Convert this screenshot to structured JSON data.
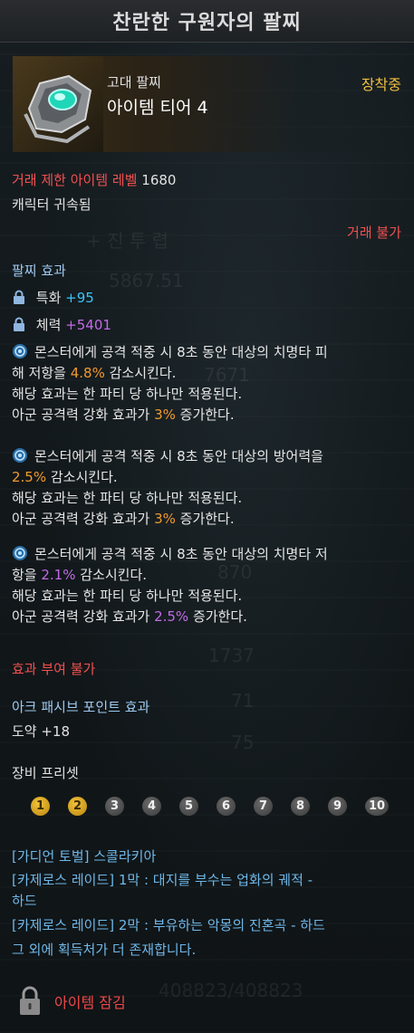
{
  "item": {
    "name": "찬란한 구원자의 팔찌",
    "grade": "고대 팔찌",
    "tier": "아이템 티어 4",
    "equipped": "장착중"
  },
  "trade": {
    "level_label": "거래 제한 아이템 레벨",
    "level_value": "1680",
    "bound": "캐릭터 귀속됨",
    "untradeable": "거래 불가"
  },
  "effects": {
    "heading": "팔찌 효과",
    "stats": [
      {
        "label": "특화",
        "value": "+95"
      },
      {
        "label": "체력",
        "value": "+5401"
      }
    ],
    "special": [
      {
        "line1a": "몬스터에게 공격 적중 시 8초 동안 대상의 치명타 피",
        "line2a": "해 저항을 ",
        "value": "4.8%",
        "line2b": " 감소시킨다.",
        "line3": "해당 효과는 한 파티 당 하나만 적용된다.",
        "line4a": "아군 공격력 강화 효과가 ",
        "bonus": "3%",
        "line4b": " 증가한다."
      },
      {
        "line1a": "몬스터에게 공격 적중 시 8초 동안 대상의 방어력을",
        "value": "2.5%",
        "line2b": " 감소시킨다.",
        "line3": "해당 효과는 한 파티 당 하나만 적용된다.",
        "line4a": "아군 공격력 강화 효과가 ",
        "bonus": "3%",
        "line4b": " 증가한다."
      },
      {
        "line1a": "몬스터에게 공격 적중 시 8초 동안 대상의 치명타 저",
        "line2a": "항을 ",
        "value": "2.1%",
        "line2b": " 감소시킨다.",
        "line3": "해당 효과는 한 파티 당 하나만 적용된다.",
        "line4a": "아군 공격력 강화 효과가 ",
        "bonus": "2.5%",
        "line4b": " 증가한다."
      }
    ],
    "no_grant": "효과 부여 불가"
  },
  "ark_passive": {
    "heading": "아크 패시브 포인트 효과",
    "value": "도약 +18"
  },
  "presets": {
    "heading": "장비 프리셋",
    "items": [
      "1",
      "2",
      "3",
      "4",
      "5",
      "6",
      "7",
      "8",
      "9",
      "10"
    ],
    "active": [
      "1",
      "2"
    ]
  },
  "sources": [
    "[가디언 토벌] 스콜라키아",
    "[카제로스 레이드] 1막 : 대지를 부수는 업화의 궤적 -",
    "하드",
    "[카제로스 레이드] 2막 : 부유하는 악몽의 진혼곡 - 하드",
    "그 외에 획득처가 더 존재합니다."
  ],
  "lock": {
    "label": "아이템 잠김"
  },
  "colors": {
    "accent_gold": "#f0c040",
    "warning_red": "#f05050",
    "heading_blue": "#9ec9f0",
    "value_orange": "#f39a2c",
    "value_cyan": "#39c6f5",
    "value_purple": "#c26ae8",
    "source_blue": "#6fb7e8"
  }
}
